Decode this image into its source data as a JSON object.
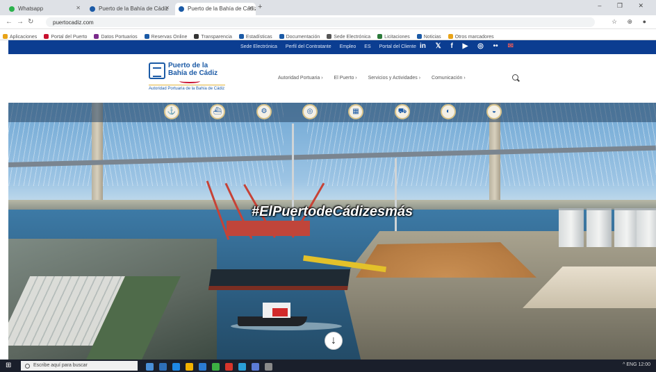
{
  "browser": {
    "tabs": [
      {
        "title": "Whatsapp",
        "color": "#2bb24c"
      },
      {
        "title": "Puerto de la Bahía de Cádiz",
        "color": "#1b5aa6"
      },
      {
        "title": "Puerto de la Bahía de Cádiz",
        "color": "#1b5aa6"
      }
    ],
    "new_tab": "+",
    "window_controls": "– ❐ ✕",
    "url": "puertocadiz.com",
    "bookmarks": [
      {
        "label": "Aplicaciones",
        "color": "#e8a317"
      },
      {
        "label": "Portal del Puerto",
        "color": "#c8102e"
      },
      {
        "label": "Datos Portuarios",
        "color": "#7a2a8a"
      },
      {
        "label": "Reservas Online",
        "color": "#1b5aa6"
      },
      {
        "label": "Transparencia",
        "color": "#333333"
      },
      {
        "label": "Estadísticas",
        "color": "#1b5aa6"
      },
      {
        "label": "Documentación",
        "color": "#1b5aa6"
      },
      {
        "label": "Sede Electrónica",
        "color": "#555555"
      },
      {
        "label": "Licitaciones",
        "color": "#2b7a3a"
      },
      {
        "label": "Noticias",
        "color": "#1b5aa6"
      },
      {
        "label": "Otros marcadores",
        "color": "#e8a317"
      }
    ]
  },
  "topbar": {
    "links": [
      "Sede Electrónica",
      "Perfil del Contratante",
      "Empleo",
      "ES",
      "Portal del Cliente"
    ],
    "social": [
      "in",
      "𝕏",
      "f",
      "▶",
      "◎",
      "••",
      "✉"
    ],
    "bg_color": "#0b3d91"
  },
  "header": {
    "logo_line1": "Puerto de la",
    "logo_line2": "Bahía de Cádiz",
    "logo_tagline": "Autoridad Portuaria de la Bahía de Cádiz",
    "nav": [
      "Autoridad Portuaria ›",
      "El Puerto ›",
      "Servicios y Actividades ›",
      "Comunicación ›"
    ]
  },
  "hero": {
    "quick_icons": [
      "⚓",
      "⛴",
      "⚙",
      "◎",
      "▦",
      "⛟",
      "◐",
      "◒"
    ],
    "hashtag": "#ElPuertodeCádizesmás",
    "scroll_down": "↓"
  },
  "taskbar": {
    "search_placeholder": "Escribe aquí para buscar",
    "apps": [
      "#4a90d9",
      "#2e6fba",
      "#1e88e5",
      "#f2b200",
      "#2b7bd3",
      "#3cb043",
      "#d9352b",
      "#2a9fd6",
      "#5b7bd5",
      "#8a8a8a"
    ],
    "tray_text": "^ ENG 12:00"
  }
}
